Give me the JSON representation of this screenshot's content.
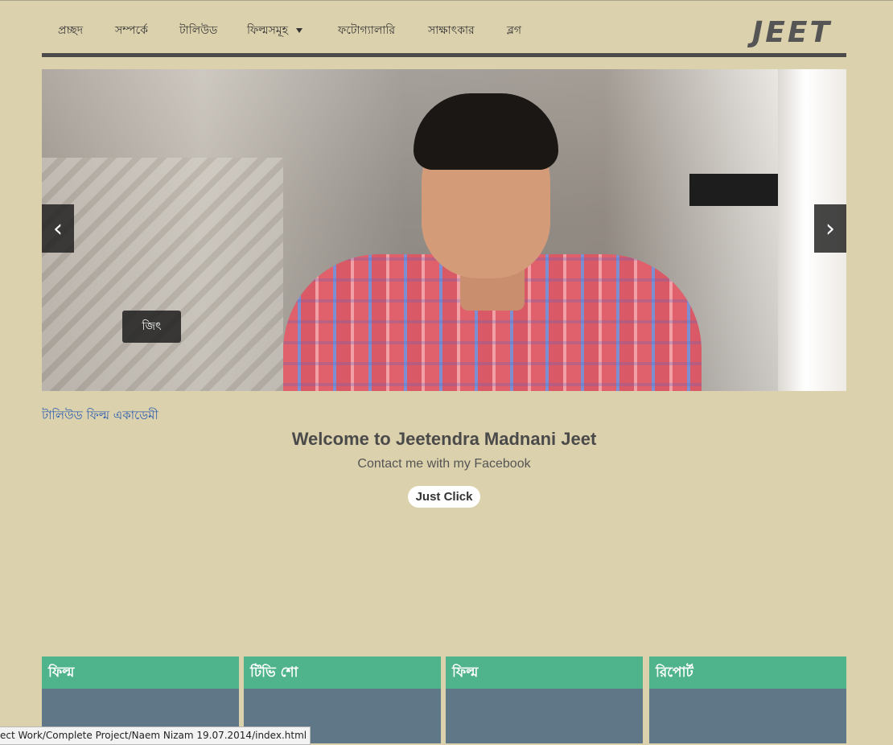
{
  "nav": {
    "items": [
      {
        "label": "প্রচ্ছদ"
      },
      {
        "label": "সম্পর্কে"
      },
      {
        "label": "টালিউড"
      },
      {
        "label": "ফিল্মসমূহ"
      },
      {
        "label": "ফটোগ্যালারি"
      },
      {
        "label": "সাক্ষাৎকার"
      },
      {
        "label": "ব্লগ"
      }
    ],
    "logo": "JEET"
  },
  "carousel": {
    "caption": "জিৎ",
    "prev_glyph": "‹",
    "next_glyph": "›"
  },
  "main": {
    "academy_link": "টালিউড ফিল্ম একাডেমী",
    "welcome": "Welcome to Jeetendra Madnani Jeet",
    "contact": "Contact me with my Facebook",
    "button": "Just Click"
  },
  "cards": [
    {
      "title": "ফিল্ম"
    },
    {
      "title": "টিভি শো"
    },
    {
      "title": "ফিল্ম"
    },
    {
      "title": "রিপোর্ট"
    }
  ],
  "status_bar": {
    "text": "ect Work/Complete Project/Naem Nizam 19.07.2014/index.html"
  },
  "colors": {
    "page_bg": "#dcd1ad",
    "card_header": "#4fb38b",
    "card_body": "#5f7787",
    "link": "#2a5db0"
  }
}
